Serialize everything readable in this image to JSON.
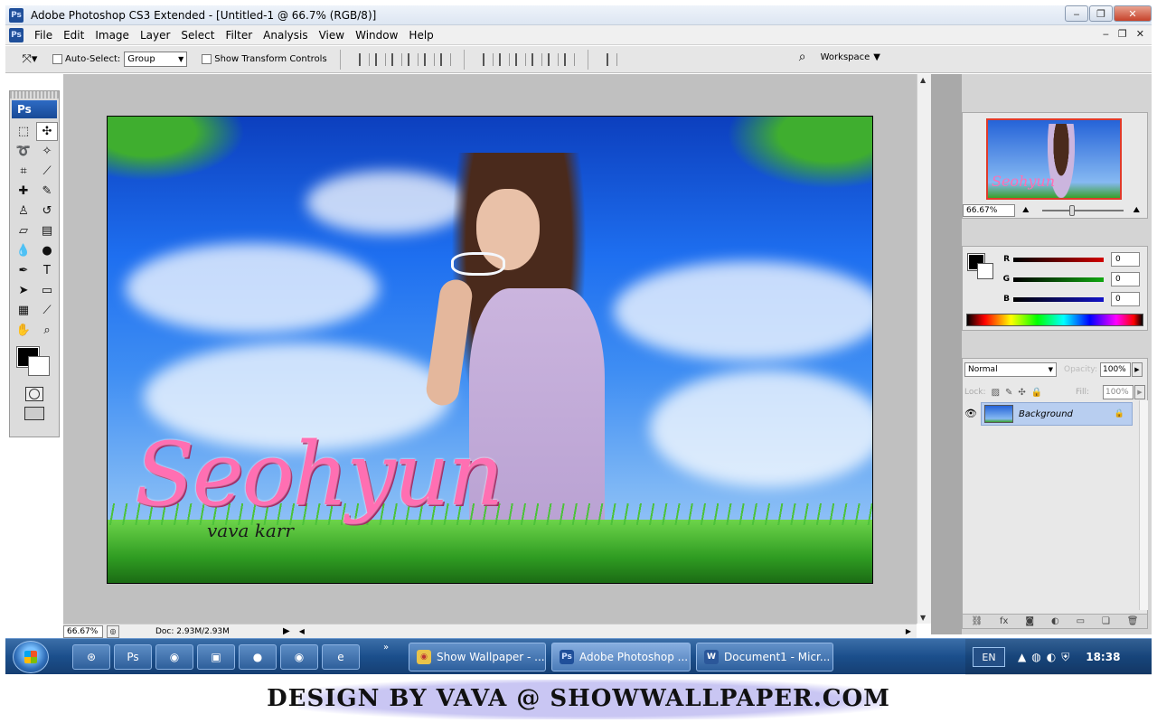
{
  "window": {
    "title": "Adobe Photoshop CS3 Extended - [Untitled-1 @ 66.7% (RGB/8)]",
    "app_icon": "Ps"
  },
  "menu": {
    "items": [
      "File",
      "Edit",
      "Image",
      "Layer",
      "Select",
      "Filter",
      "Analysis",
      "View",
      "Window",
      "Help"
    ]
  },
  "options": {
    "auto_select_label": "Auto-Select:",
    "auto_select_value": "Group",
    "transform_label": "Show Transform Controls",
    "workspace_label": "Workspace"
  },
  "toolbox": {
    "logo": "Ps"
  },
  "canvas": {
    "title_text": "Seohyun",
    "subtitle_text": "vava karr"
  },
  "statusbar": {
    "zoom": "66.67%",
    "doc_info": "Doc: 2.93M/2.93M"
  },
  "navigator": {
    "zoom": "66.67%",
    "thumb_text": "Seohyun"
  },
  "color_panel": {
    "channels": [
      {
        "label": "R",
        "value": "0",
        "color": "#d10000"
      },
      {
        "label": "G",
        "value": "0",
        "color": "#12a812"
      },
      {
        "label": "B",
        "value": "0",
        "color": "#1414c8"
      }
    ]
  },
  "layers_panel": {
    "blend_mode": "Normal",
    "opacity_label": "Opacity:",
    "opacity_value": "100%",
    "lock_label": "Lock:",
    "fill_label": "Fill:",
    "fill_value": "100%",
    "layer_name": "Background"
  },
  "taskbar": {
    "buttons": [
      {
        "label": "Show Wallpaper - ...",
        "icon": "chrome-icon"
      },
      {
        "label": "Adobe Photoshop ...",
        "icon": "photoshop-icon"
      },
      {
        "label": "Document1 - Micr...",
        "icon": "word-icon"
      }
    ],
    "language": "EN",
    "clock": "18:38"
  },
  "footer": {
    "watermark": "DESIGN BY VAVA @ SHOWWALLPAPER.COM"
  }
}
